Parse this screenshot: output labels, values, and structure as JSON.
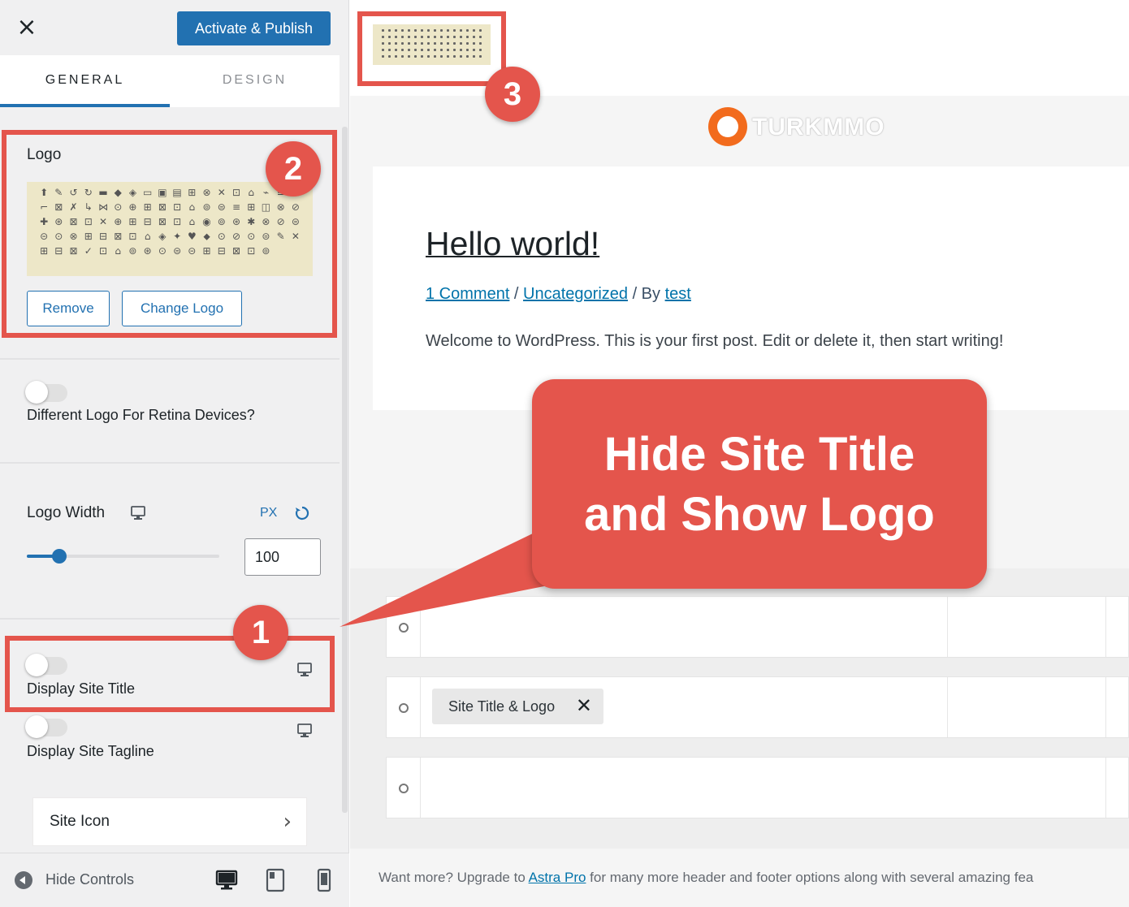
{
  "sidebar": {
    "close_glyph": "×",
    "publish_label": "Activate & Publish",
    "tabs": [
      {
        "label": "GENERAL",
        "active": true
      },
      {
        "label": "DESIGN",
        "active": false
      }
    ],
    "logo": {
      "label": "Logo",
      "remove_label": "Remove",
      "change_label": "Change Logo",
      "icons": "⬆✎↺↻▬◆◈▭▣▤⊞⊗✕⊡⌂⌁≡⊟⌐⊠✗↳⋈⊙⊕⊞⊠⊡⌂⊚⊜≡⊞◫⊗⊘✚⊛⊠⊡✕⊕⊞⊟⊠⊡⌂◉⊚⊛✱⊗⊘⊜⊝⊙⊗⊞⊟⊠⊡⌂◈✦♥⬥⊙⊘⊙⊜✎✕⊞⊟⊠✓⊡⌂⊚⊛⊙⊜⊝⊞⊟⊠⊡⊚"
    },
    "retina": {
      "label": "Different Logo For Retina Devices?"
    },
    "logo_width": {
      "label": "Logo Width",
      "unit": "PX",
      "value": "100",
      "slider_fraction": 0.17
    },
    "display_site_title": {
      "label": "Display Site Title"
    },
    "display_site_tagline": {
      "label": "Display Site Tagline"
    },
    "site_icon": {
      "label": "Site Icon",
      "chevron": "›"
    },
    "footer": {
      "hide_controls_label": "Hide Controls"
    }
  },
  "preview": {
    "watermark": "TURKMMO",
    "post": {
      "title": "Hello world!",
      "meta_comment": "1 Comment",
      "meta_sep1": " / ",
      "meta_category": "Uncategorized",
      "meta_sep2": " / By ",
      "meta_author": "test",
      "body": "Welcome to WordPress. This is your first post. Edit or delete it, then start writing!"
    },
    "builder": {
      "chip_label": "Site Title & Logo",
      "chip_remove": "✕"
    },
    "upgrade": {
      "prefix": "Want more? Upgrade to ",
      "link": "Astra Pro",
      "suffix": " for many more header and footer options along with several amazing fea"
    }
  },
  "annotations": {
    "badge_1": "1",
    "badge_2": "2",
    "badge_3": "3",
    "callout": "Hide Site Title\nand Show Logo",
    "color": "#e4554c"
  },
  "colors": {
    "accent": "#2271b1",
    "annotation": "#e4554c",
    "watermark_orange": "#f26b1d"
  }
}
